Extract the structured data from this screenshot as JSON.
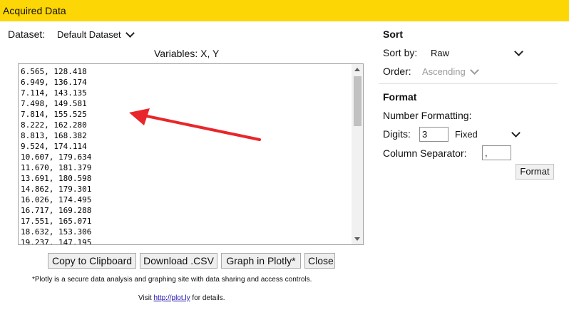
{
  "window": {
    "title": "Acquired Data"
  },
  "dataset": {
    "label": "Dataset:",
    "value": "Default Dataset"
  },
  "variables_text": "Variables: X, Y",
  "data_lines": [
    "6.565, 128.418",
    "6.949, 136.174",
    "7.114, 143.135",
    "7.498, 149.581",
    "7.814, 155.525",
    "8.222, 162.280",
    "8.813, 168.382",
    "9.524, 174.114",
    "10.607, 179.634",
    "11.670, 181.379",
    "13.691, 180.598",
    "14.862, 179.301",
    "16.026, 174.495",
    "16.717, 169.288",
    "17.551, 165.071",
    "18.632, 153.306",
    "19.237, 147.195"
  ],
  "buttons": {
    "copy": "Copy to Clipboard",
    "download": "Download .CSV",
    "plotly": "Graph in Plotly*",
    "close": "Close"
  },
  "footnote": {
    "plotly_note": "*Plotly is a secure data analysis and graphing site with data sharing and access controls.",
    "visit_prefix": "Visit",
    "link": "http://plot.ly",
    "visit_suffix": "for details."
  },
  "sort": {
    "heading": "Sort",
    "sort_by_label": "Sort by:",
    "sort_by_value": "Raw",
    "order_label": "Order:",
    "order_value": "Ascending"
  },
  "format": {
    "heading": "Format",
    "number_formatting_label": "Number Formatting:",
    "digits_label": "Digits:",
    "digits_value": "3",
    "digits_mode": "Fixed",
    "column_separator_label": "Column Separator:",
    "column_separator_value": ",",
    "format_button": "Format"
  },
  "colors": {
    "titlebar": "#fdd605",
    "annotation_arrow": "#e8262b"
  }
}
